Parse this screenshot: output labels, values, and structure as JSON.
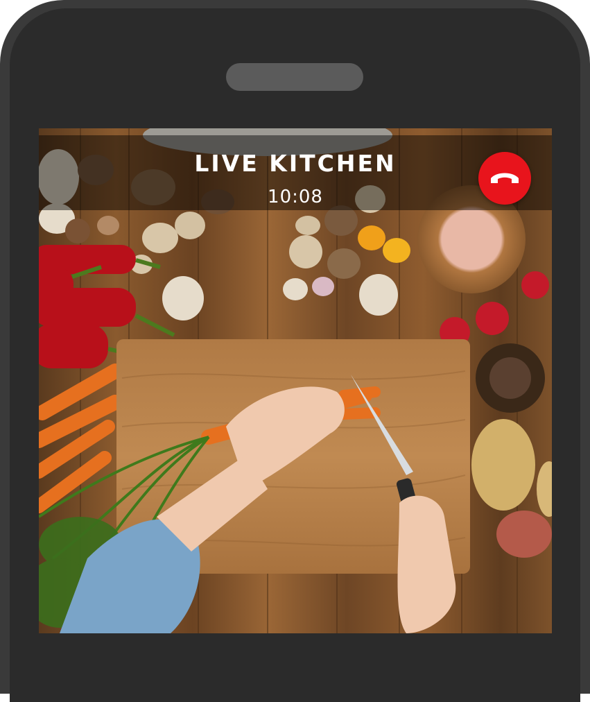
{
  "call": {
    "title": "LIVE KITCHEN",
    "timer": "10:08"
  },
  "icons": {
    "end_call": "phone-hangup-icon"
  },
  "colors": {
    "end_call_button": "#e8141c",
    "phone_frame": "#2b2b2b"
  }
}
